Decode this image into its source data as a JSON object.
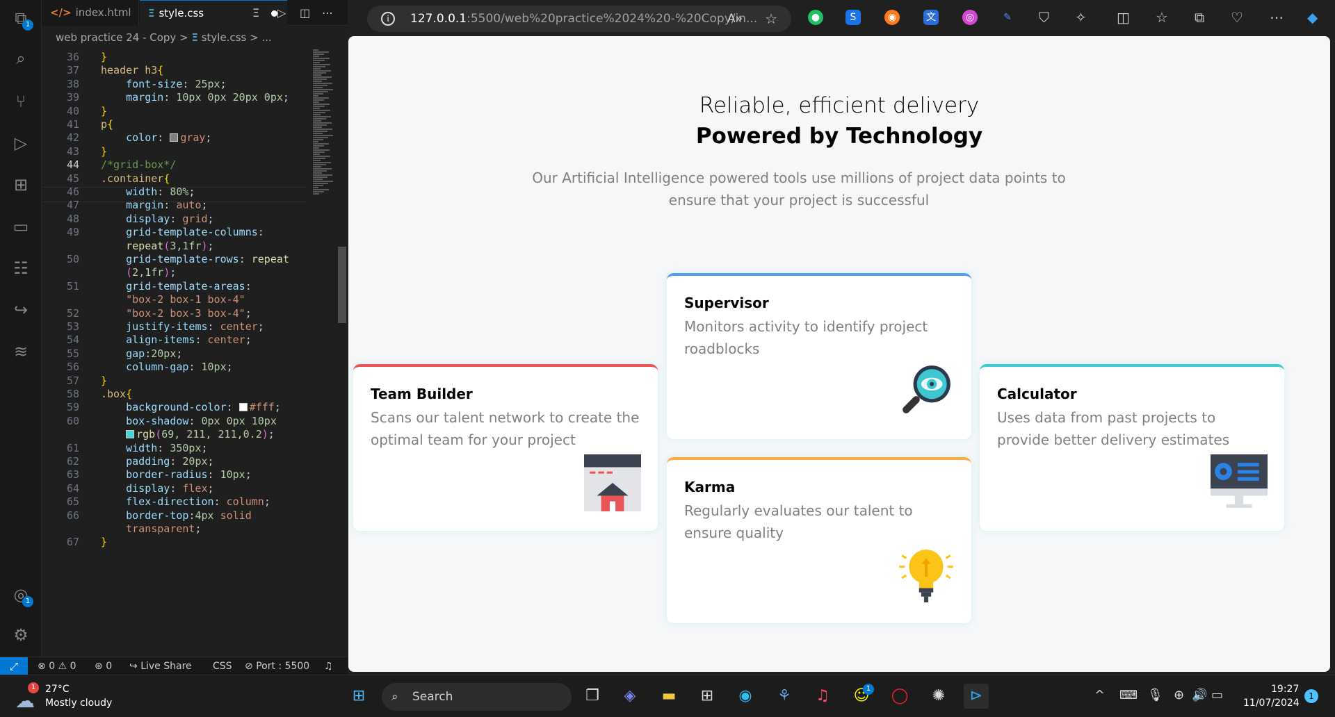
{
  "vscode": {
    "activity_badges": {
      "explorer": "1",
      "accounts": "1"
    },
    "tabs": [
      {
        "label": "index.html",
        "icon": "html-icon"
      },
      {
        "label": "style.css",
        "icon": "css-icon",
        "modified": true
      }
    ],
    "breadcrumb": {
      "folder": "web practice 24 - Copy",
      "sep": ">",
      "file": "style.css",
      "more": "> ..."
    },
    "line_numbers": [
      "36",
      "37",
      "38",
      "39",
      "40",
      "41",
      "42",
      "43",
      "44",
      "45",
      "46",
      "47",
      "48",
      "49",
      "",
      "50",
      "",
      "51",
      "",
      "52",
      "53",
      "54",
      "55",
      "56",
      "57",
      "58",
      "59",
      "60",
      "",
      "61",
      "62",
      "63",
      "64",
      "65",
      "66",
      "",
      "67"
    ],
    "code_lines": [
      [
        {
          "c": "br",
          "t": "}"
        }
      ],
      [
        {
          "c": "sel",
          "t": "header h3"
        },
        {
          "c": "br",
          "t": "{"
        }
      ],
      [
        {
          "c": "",
          "t": "    "
        },
        {
          "c": "prop",
          "t": "font-size"
        },
        {
          "c": "",
          "t": ": "
        },
        {
          "c": "num",
          "t": "25px"
        },
        {
          "c": "",
          "t": ";"
        }
      ],
      [
        {
          "c": "",
          "t": "    "
        },
        {
          "c": "prop",
          "t": "margin"
        },
        {
          "c": "",
          "t": ": "
        },
        {
          "c": "num",
          "t": "10px 0px 20px 0px"
        },
        {
          "c": "",
          "t": ";"
        }
      ],
      [
        {
          "c": "br",
          "t": "}"
        }
      ],
      [
        {
          "c": "sel",
          "t": "p"
        },
        {
          "c": "br",
          "t": "{"
        }
      ],
      [
        {
          "c": "",
          "t": "    "
        },
        {
          "c": "prop",
          "t": "color"
        },
        {
          "c": "",
          "t": ": "
        },
        {
          "c": "swatch",
          "t": "#808080"
        },
        {
          "c": "val",
          "t": "gray"
        },
        {
          "c": "",
          "t": ";"
        }
      ],
      [
        {
          "c": "br",
          "t": "}"
        }
      ],
      [
        {
          "c": "cmt",
          "t": "/*grid-box*/"
        }
      ],
      [
        {
          "c": "sel",
          "t": ".container"
        },
        {
          "c": "br",
          "t": "{"
        }
      ],
      [
        {
          "c": "",
          "t": "    "
        },
        {
          "c": "prop",
          "t": "width"
        },
        {
          "c": "",
          "t": ": "
        },
        {
          "c": "num",
          "t": "80%"
        },
        {
          "c": "",
          "t": ";"
        }
      ],
      [
        {
          "c": "",
          "t": "    "
        },
        {
          "c": "prop",
          "t": "margin"
        },
        {
          "c": "",
          "t": ": "
        },
        {
          "c": "val",
          "t": "auto"
        },
        {
          "c": "",
          "t": ";"
        }
      ],
      [
        {
          "c": "",
          "t": "    "
        },
        {
          "c": "prop",
          "t": "display"
        },
        {
          "c": "",
          "t": ": "
        },
        {
          "c": "val",
          "t": "grid"
        },
        {
          "c": "",
          "t": ";"
        }
      ],
      [
        {
          "c": "",
          "t": "    "
        },
        {
          "c": "prop",
          "t": "grid-template-columns"
        },
        {
          "c": "",
          "t": ":"
        }
      ],
      [
        {
          "c": "",
          "t": "    "
        },
        {
          "c": "fn",
          "t": "repeat"
        },
        {
          "c": "br2",
          "t": "("
        },
        {
          "c": "num",
          "t": "3"
        },
        {
          "c": "",
          "t": ","
        },
        {
          "c": "num",
          "t": "1fr"
        },
        {
          "c": "br2",
          "t": ")"
        },
        {
          "c": "",
          "t": ";"
        }
      ],
      [
        {
          "c": "",
          "t": "    "
        },
        {
          "c": "prop",
          "t": "grid-template-rows"
        },
        {
          "c": "",
          "t": ": "
        },
        {
          "c": "fn",
          "t": "repeat"
        }
      ],
      [
        {
          "c": "",
          "t": "    "
        },
        {
          "c": "br2",
          "t": "("
        },
        {
          "c": "num",
          "t": "2"
        },
        {
          "c": "",
          "t": ","
        },
        {
          "c": "num",
          "t": "1fr"
        },
        {
          "c": "br2",
          "t": ")"
        },
        {
          "c": "",
          "t": ";"
        }
      ],
      [
        {
          "c": "",
          "t": "    "
        },
        {
          "c": "prop",
          "t": "grid-template-areas"
        },
        {
          "c": "",
          "t": ":"
        }
      ],
      [
        {
          "c": "",
          "t": "    "
        },
        {
          "c": "val",
          "t": "\"box-2 box-1 box-4\""
        }
      ],
      [
        {
          "c": "",
          "t": "    "
        },
        {
          "c": "val",
          "t": "\"box-2 box-3 box-4\""
        },
        {
          "c": "",
          "t": ";"
        }
      ],
      [
        {
          "c": "",
          "t": "    "
        },
        {
          "c": "prop",
          "t": "justify-items"
        },
        {
          "c": "",
          "t": ": "
        },
        {
          "c": "val",
          "t": "center"
        },
        {
          "c": "",
          "t": ";"
        }
      ],
      [
        {
          "c": "",
          "t": "    "
        },
        {
          "c": "prop",
          "t": "align-items"
        },
        {
          "c": "",
          "t": ": "
        },
        {
          "c": "val",
          "t": "center"
        },
        {
          "c": "",
          "t": ";"
        }
      ],
      [
        {
          "c": "",
          "t": "    "
        },
        {
          "c": "prop",
          "t": "gap"
        },
        {
          "c": "",
          "t": ":"
        },
        {
          "c": "num",
          "t": "20px"
        },
        {
          "c": "",
          "t": ";"
        }
      ],
      [
        {
          "c": "",
          "t": "    "
        },
        {
          "c": "prop",
          "t": "column-gap"
        },
        {
          "c": "",
          "t": ": "
        },
        {
          "c": "num",
          "t": "10px"
        },
        {
          "c": "",
          "t": ";"
        }
      ],
      [
        {
          "c": "br",
          "t": "}"
        }
      ],
      [
        {
          "c": "sel",
          "t": ".box"
        },
        {
          "c": "br",
          "t": "{"
        }
      ],
      [
        {
          "c": "",
          "t": "    "
        },
        {
          "c": "prop",
          "t": "background-color"
        },
        {
          "c": "",
          "t": ": "
        },
        {
          "c": "swatch",
          "t": "#ffffff"
        },
        {
          "c": "val",
          "t": "#fff"
        },
        {
          "c": "",
          "t": ";"
        }
      ],
      [
        {
          "c": "",
          "t": "    "
        },
        {
          "c": "prop",
          "t": "box-shadow"
        },
        {
          "c": "",
          "t": ": "
        },
        {
          "c": "num",
          "t": "0px 0px 10px"
        }
      ],
      [
        {
          "c": "",
          "t": "    "
        },
        {
          "c": "swatch",
          "t": "#45d3d3"
        },
        {
          "c": "fn",
          "t": "rgb"
        },
        {
          "c": "br2",
          "t": "("
        },
        {
          "c": "num",
          "t": "69, 211, 211,0.2"
        },
        {
          "c": "br2",
          "t": ")"
        },
        {
          "c": "",
          "t": ";"
        }
      ],
      [
        {
          "c": "",
          "t": "    "
        },
        {
          "c": "prop",
          "t": "width"
        },
        {
          "c": "",
          "t": ": "
        },
        {
          "c": "num",
          "t": "350px"
        },
        {
          "c": "",
          "t": ";"
        }
      ],
      [
        {
          "c": "",
          "t": "    "
        },
        {
          "c": "prop",
          "t": "padding"
        },
        {
          "c": "",
          "t": ": "
        },
        {
          "c": "num",
          "t": "20px"
        },
        {
          "c": "",
          "t": ";"
        }
      ],
      [
        {
          "c": "",
          "t": "    "
        },
        {
          "c": "prop",
          "t": "border-radius"
        },
        {
          "c": "",
          "t": ": "
        },
        {
          "c": "num",
          "t": "10px"
        },
        {
          "c": "",
          "t": ";"
        }
      ],
      [
        {
          "c": "",
          "t": "    "
        },
        {
          "c": "prop",
          "t": "display"
        },
        {
          "c": "",
          "t": ": "
        },
        {
          "c": "val",
          "t": "flex"
        },
        {
          "c": "",
          "t": ";"
        }
      ],
      [
        {
          "c": "",
          "t": "    "
        },
        {
          "c": "prop",
          "t": "flex-direction"
        },
        {
          "c": "",
          "t": ": "
        },
        {
          "c": "val",
          "t": "column"
        },
        {
          "c": "",
          "t": ";"
        }
      ],
      [
        {
          "c": "",
          "t": "    "
        },
        {
          "c": "prop",
          "t": "border-top"
        },
        {
          "c": "",
          "t": ":"
        },
        {
          "c": "num",
          "t": "4px"
        },
        {
          "c": "val",
          "t": " solid"
        }
      ],
      [
        {
          "c": "",
          "t": "    "
        },
        {
          "c": "val",
          "t": "transparent"
        },
        {
          "c": "",
          "t": ";"
        }
      ],
      [
        {
          "c": "br",
          "t": "}"
        }
      ]
    ],
    "status": {
      "errors": "0",
      "warnings": "0",
      "ports": "0",
      "live_share": "Live Share",
      "language": "CSS",
      "port": "Port : 5500"
    }
  },
  "browser": {
    "url_host": "127.0.0.1",
    "url_rest": ":5500/web%20practice%2024%20-%20Copy/in...",
    "page": {
      "heading_light": "Reliable, efficient delivery",
      "heading_bold": "Powered by Technology",
      "intro": "Our Artificial Intelligence powered tools use millions of project data points to ensure that your project is successful",
      "cards": [
        {
          "title": "Supervisor",
          "desc": "Monitors activity to identify project roadblocks",
          "accent": "#549ef2",
          "icon": "magnifier-eye-icon"
        },
        {
          "title": "Team Builder",
          "desc": "Scans our talent network to create the optimal team for your project",
          "accent": "#ea5454",
          "icon": "browser-house-icon"
        },
        {
          "title": "Karma",
          "desc": "Regularly evaluates our talent to ensure quality",
          "accent": "#fcaf41",
          "icon": "lightbulb-icon"
        },
        {
          "title": "Calculator",
          "desc": "Uses data from past projects to provide better delivery estimates",
          "accent": "#3eccce",
          "icon": "monitor-dashboard-icon"
        }
      ]
    }
  },
  "taskbar": {
    "weather_temp": "27°C",
    "weather_desc": "Mostly cloudy",
    "weather_badge": "1",
    "search_placeholder": "Search",
    "snapchat_badge": "1",
    "time": "19:27",
    "date": "11/07/2024",
    "notif_count": "1"
  }
}
